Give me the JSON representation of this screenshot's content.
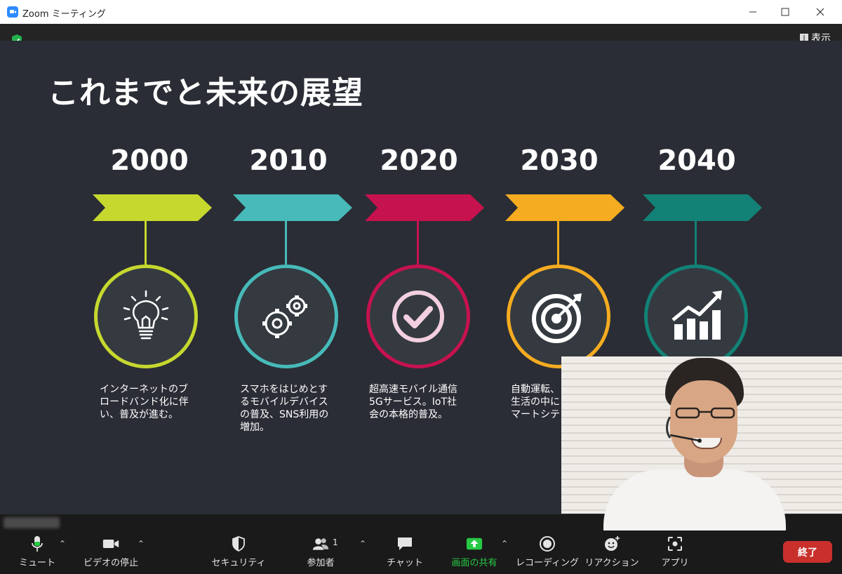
{
  "window": {
    "title": "Zoom ミーティング"
  },
  "topbar": {
    "view_label": "表示"
  },
  "slide": {
    "title": "これまでと未来の展望",
    "milestones": [
      {
        "year": "2000",
        "color": "#c6d82e",
        "icon": "lightbulb-icon",
        "text": "インターネットのブ\nロードバンド化に伴\nい、普及が進む。"
      },
      {
        "year": "2010",
        "color": "#47bab9",
        "icon": "gears-icon",
        "text": "スマホをはじめとす\nるモバイルデバイス\nの普及、SNS利用の\n増加。"
      },
      {
        "year": "2020",
        "color": "#c6124f",
        "icon": "checkmark-icon",
        "text": "超高速モバイル通信\n5Gサービス。IoT社\n会の本格的普及。"
      },
      {
        "year": "2030",
        "color": "#f5ac20",
        "icon": "target-icon",
        "text": "自動運転、\n生活の中に\nマートシテ"
      },
      {
        "year": "2040",
        "color": "#128276",
        "icon": "growth-chart-icon",
        "text": ""
      }
    ]
  },
  "toolbar": {
    "mute_label": "ミュート",
    "video_label": "ビデオの停止",
    "security_label": "セキュリティ",
    "participants_label": "参加者",
    "participants_count": "1",
    "chat_label": "チャット",
    "share_label": "画面の共有",
    "record_label": "レコーディング",
    "reaction_label": "リアクション",
    "apps_label": "アプリ",
    "end_label": "終了",
    "share_color": "#27c945",
    "end_color": "#c9302c"
  }
}
